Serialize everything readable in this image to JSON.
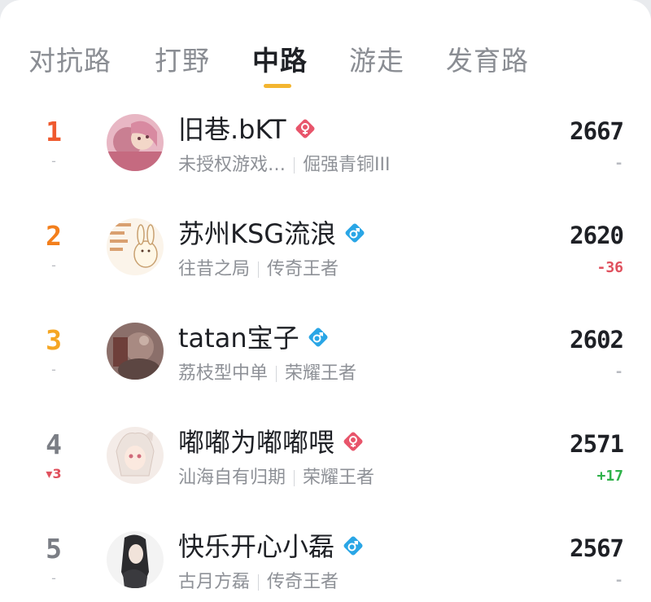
{
  "tabs": [
    {
      "label": "对抗路",
      "active": false
    },
    {
      "label": "打野",
      "active": false
    },
    {
      "label": "中路",
      "active": true
    },
    {
      "label": "游走",
      "active": false
    },
    {
      "label": "发育路",
      "active": false
    }
  ],
  "colors": {
    "accent": "#f3b530",
    "rank1": "#ef5a2f",
    "rank2": "#f37f1c",
    "rank3": "#f5a623",
    "rank_other": "#7b7e85",
    "female": "#e8556b",
    "male": "#2aa6e6",
    "delta_negative": "#e0505d",
    "delta_positive": "#2fb24a"
  },
  "rows": [
    {
      "rank": "1",
      "rank_change": "-",
      "name": "旧巷.bKT",
      "gender": "female-icon",
      "team": "未授权游戏…",
      "tier": "倔强青铜III",
      "score": "2667",
      "score_delta": "-"
    },
    {
      "rank": "2",
      "rank_change": "-",
      "name": "苏州KSG流浪",
      "gender": "male-icon",
      "team": "往昔之局",
      "tier": "传奇王者",
      "score": "2620",
      "score_delta": "-36"
    },
    {
      "rank": "3",
      "rank_change": "-",
      "name": "tatan宝子",
      "gender": "male-icon",
      "team": "荔枝型中单",
      "tier": "荣耀王者",
      "score": "2602",
      "score_delta": "-"
    },
    {
      "rank": "4",
      "rank_change": "▾3",
      "name": "嘟嘟为嘟嘟喂",
      "gender": "female-icon",
      "team": "汕海自有归期",
      "tier": "荣耀王者",
      "score": "2571",
      "score_delta": "+17"
    },
    {
      "rank": "5",
      "rank_change": "-",
      "name": "快乐开心小磊",
      "gender": "male-icon",
      "team": "古月方磊",
      "tier": "传奇王者",
      "score": "2567",
      "score_delta": "-"
    }
  ]
}
